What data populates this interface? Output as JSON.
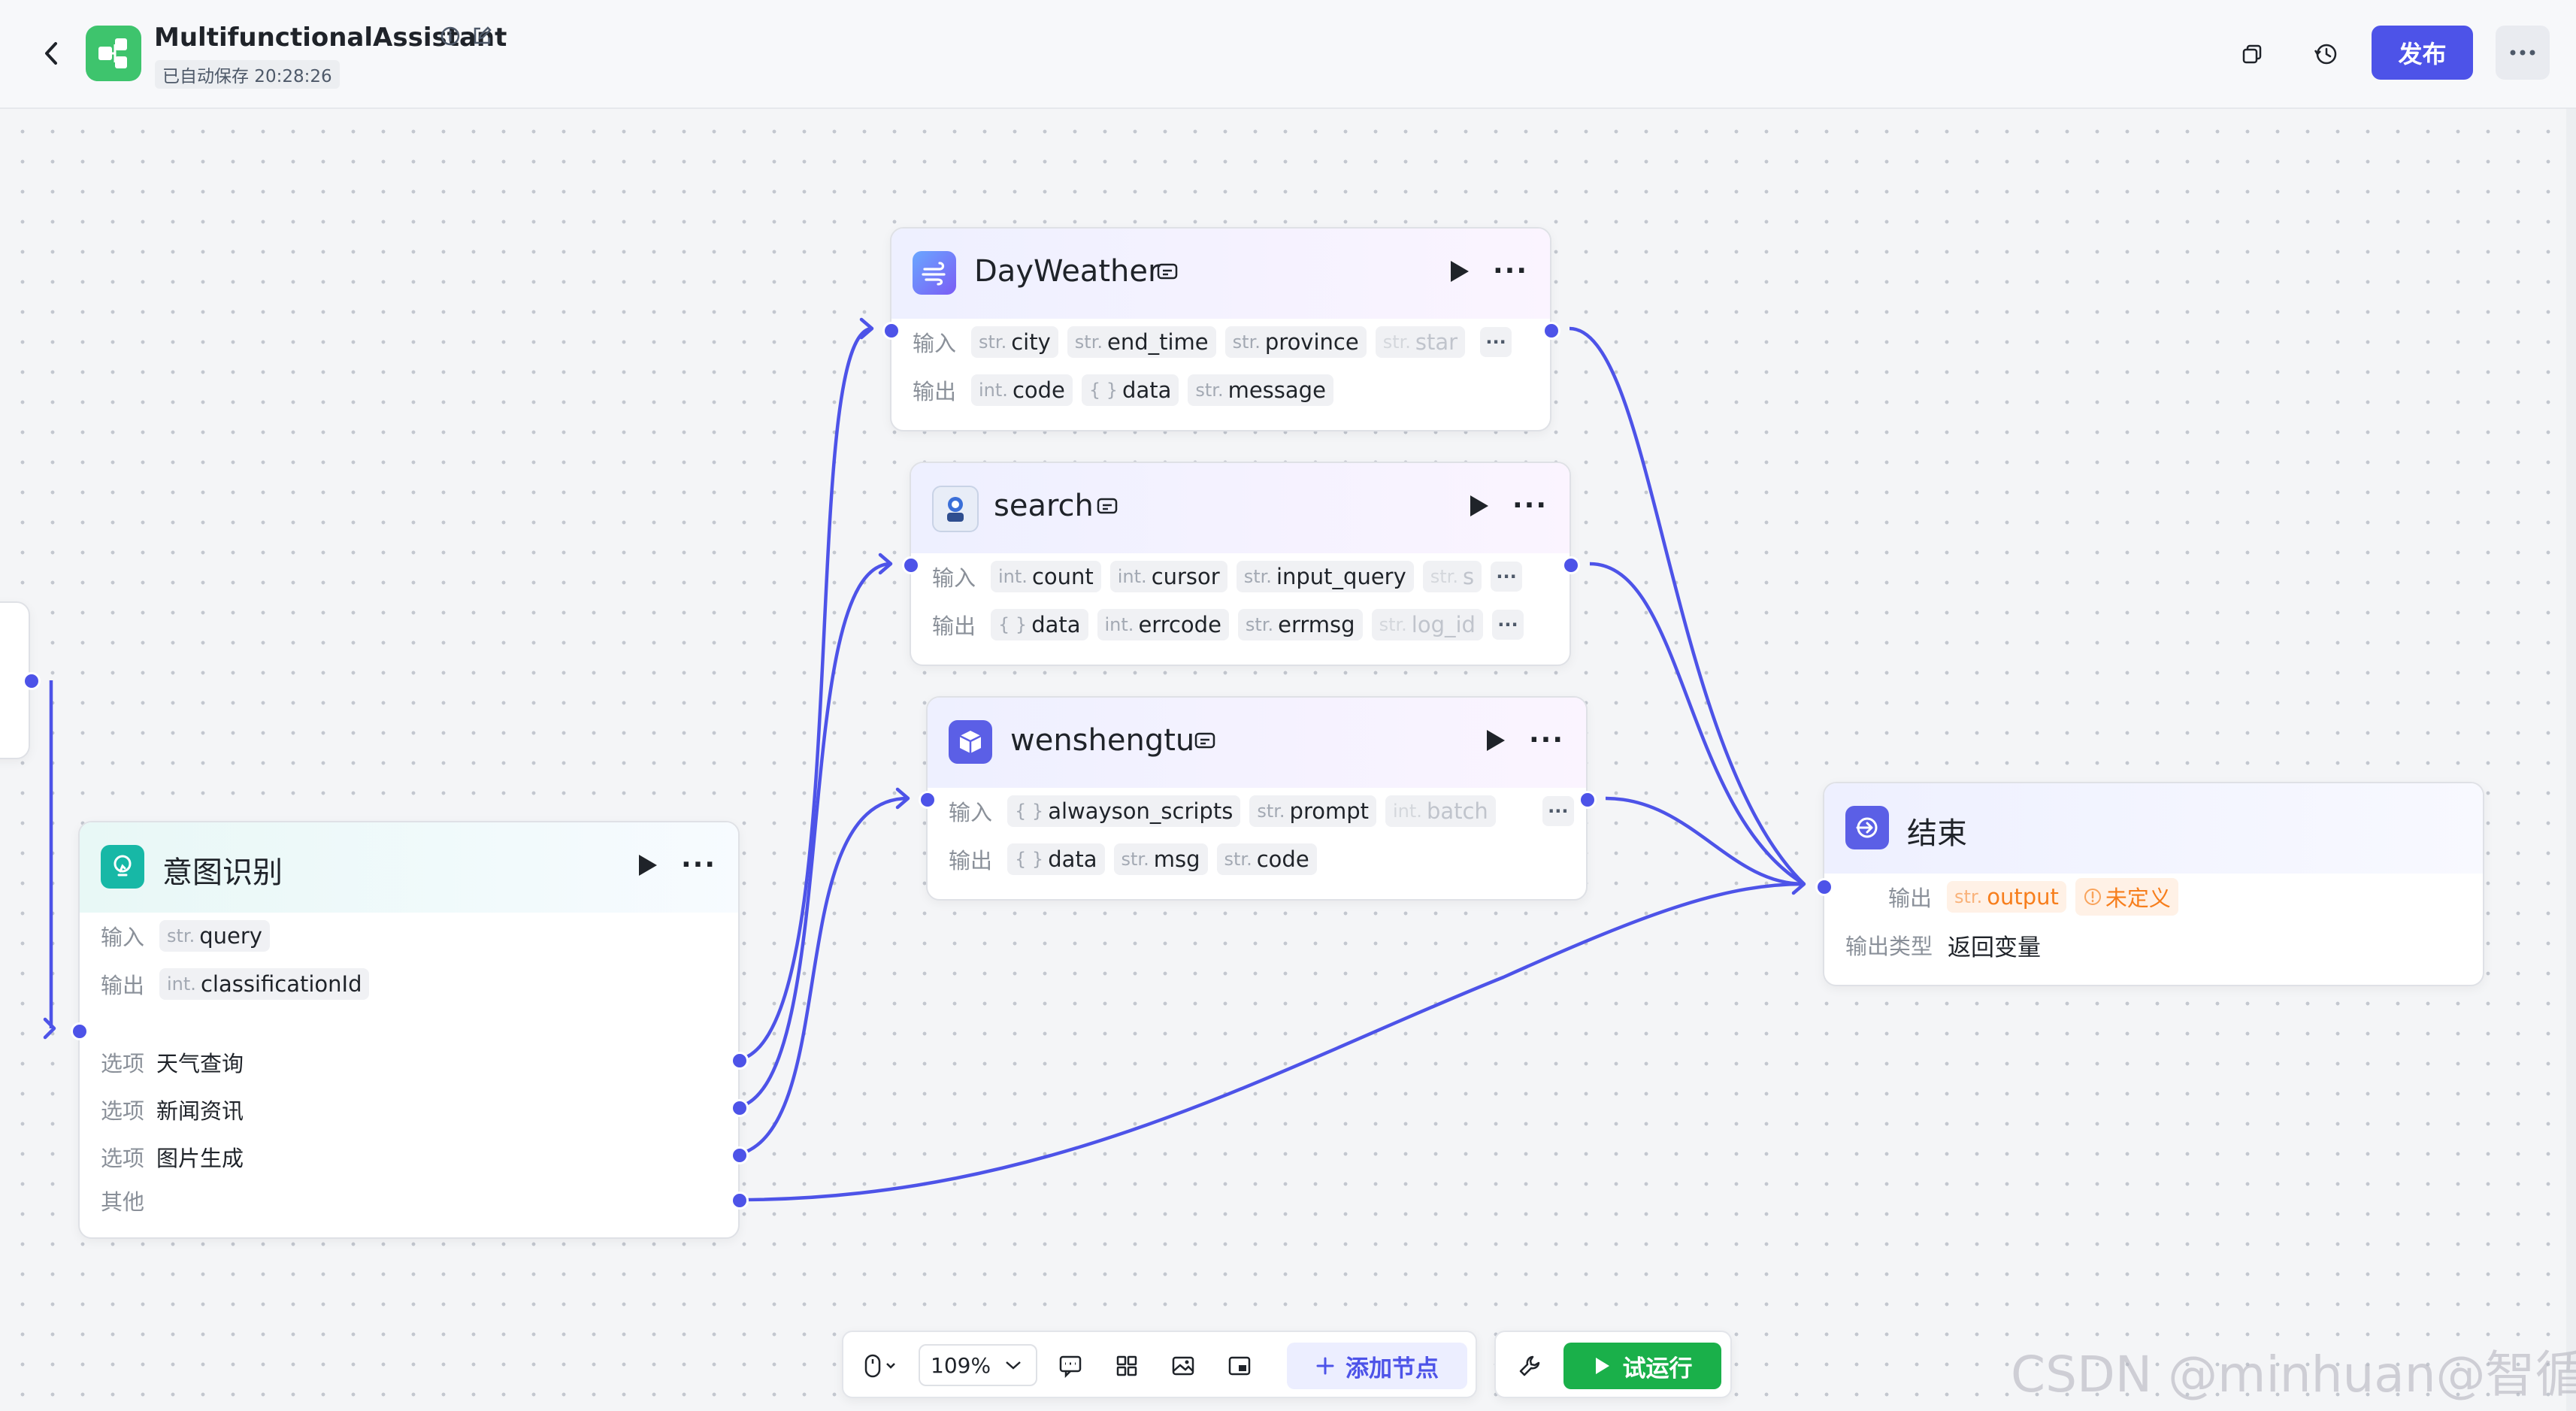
{
  "header": {
    "app_title": "MultifunctionalAssistant",
    "autosave": "已自动保存 20:28:26",
    "publish_label": "发布",
    "icons": [
      "back-icon",
      "info-icon",
      "edit-icon",
      "copy-icon",
      "history-icon",
      "more-icon"
    ]
  },
  "nodes": {
    "dayweather": {
      "title": "DayWeather",
      "input_label": "输入",
      "output_label": "输出",
      "inputs": [
        {
          "type": "str.",
          "name": "city"
        },
        {
          "type": "str.",
          "name": "end_time"
        },
        {
          "type": "str.",
          "name": "province"
        },
        {
          "type": "str.",
          "name": "star"
        }
      ],
      "outputs": [
        {
          "type": "int.",
          "name": "code"
        },
        {
          "type": "{ }",
          "name": "data"
        },
        {
          "type": "str.",
          "name": "message"
        }
      ]
    },
    "search": {
      "title": "search",
      "input_label": "输入",
      "output_label": "输出",
      "inputs": [
        {
          "type": "int.",
          "name": "count"
        },
        {
          "type": "int.",
          "name": "cursor"
        },
        {
          "type": "str.",
          "name": "input_query"
        },
        {
          "type": "str.",
          "name": "s"
        }
      ],
      "outputs": [
        {
          "type": "{ }",
          "name": "data"
        },
        {
          "type": "int.",
          "name": "errcode"
        },
        {
          "type": "str.",
          "name": "errmsg"
        },
        {
          "type": "str.",
          "name": "log_id"
        }
      ]
    },
    "wenshengtu": {
      "title": "wenshengtu",
      "input_label": "输入",
      "output_label": "输出",
      "inputs": [
        {
          "type": "{ }",
          "name": "alwayson_scripts"
        },
        {
          "type": "str.",
          "name": "prompt"
        },
        {
          "type": "int.",
          "name": "batch"
        }
      ],
      "outputs": [
        {
          "type": "{ }",
          "name": "data"
        },
        {
          "type": "str.",
          "name": "msg"
        },
        {
          "type": "str.",
          "name": "code"
        }
      ]
    },
    "intent": {
      "title": "意图识别",
      "input_label": "输入",
      "output_label": "输出",
      "input": {
        "type": "str.",
        "name": "query"
      },
      "output": {
        "type": "int.",
        "name": "classificationId"
      },
      "option_label": "选项",
      "options": [
        "天气查询",
        "新闻资讯",
        "图片生成"
      ],
      "other_label": "其他"
    },
    "end": {
      "title": "结束",
      "output_label": "输出",
      "output": {
        "type": "str.",
        "name": "output"
      },
      "undefined_label": "未定义",
      "output_type_label": "输出类型",
      "output_type_value": "返回变量"
    }
  },
  "toolbar": {
    "zoom": "109%",
    "add_node_label": "添加节点",
    "trial_run_label": "试运行",
    "icons": [
      "mouse-icon",
      "comment-icon",
      "layout-icon",
      "image-icon",
      "minimap-icon",
      "wrench-icon"
    ]
  },
  "watermark": "CSDN @minhuan@智循AI",
  "colors": {
    "accent": "#4d53e8",
    "edge": "#4d53e8",
    "run_green": "#1ab04a",
    "app_icon": "#3ec46d",
    "warning": "#f77e1c"
  }
}
